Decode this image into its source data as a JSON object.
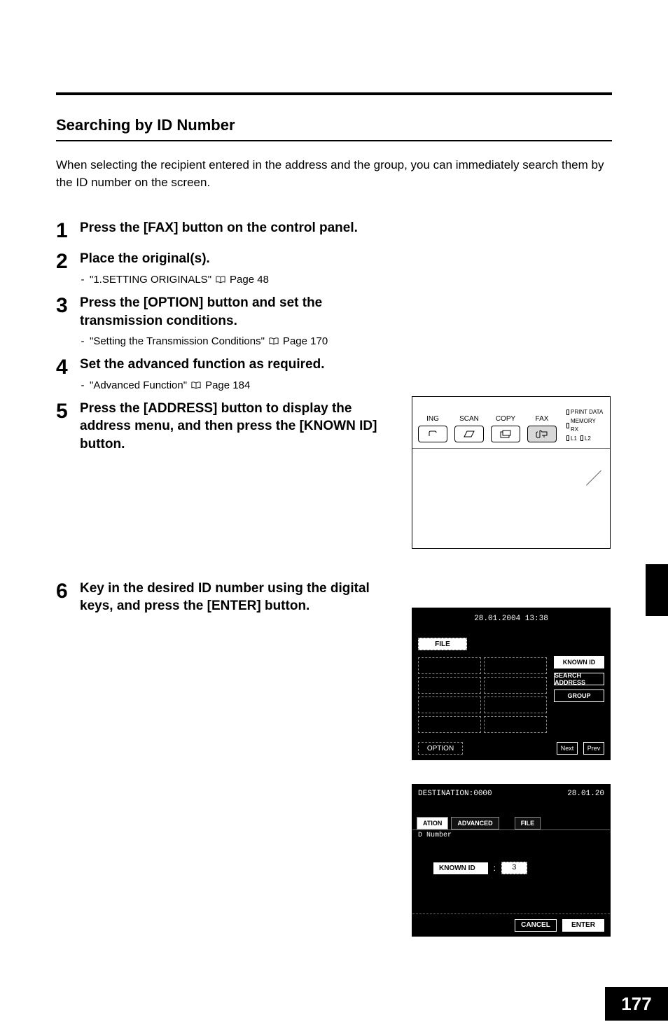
{
  "heading": "Searching by ID Number",
  "intro": "When selecting the recipient entered in the address and the group, you can immediately search them by the ID number on the screen.",
  "steps": [
    {
      "num": "1",
      "title": "Press the [FAX] button on the control panel."
    },
    {
      "num": "2",
      "title": "Place the original(s).",
      "ref_text": "\"1.SETTING ORIGINALS\"",
      "ref_page": "Page 48"
    },
    {
      "num": "3",
      "title": "Press the [OPTION] button and set the transmission conditions.",
      "ref_text": "\"Setting the Transmission Conditions\"",
      "ref_page": "Page 170"
    },
    {
      "num": "4",
      "title": "Set the advanced function as required.",
      "ref_text": "\"Advanced Function\"",
      "ref_page": "Page 184"
    },
    {
      "num": "5",
      "title": "Press the [ADDRESS] button to display the address menu, and then press the [KNOWN ID] button."
    },
    {
      "num": "6",
      "title": "Key in the desired ID number using the digital keys, and press the [ENTER] button."
    }
  ],
  "panel": {
    "btn1": "ING",
    "btn2": "SCAN",
    "btn3": "COPY",
    "btn4": "FAX",
    "side1": "PRINT DATA",
    "side2": "MEMORY RX",
    "side3": "L1",
    "side4": "L2"
  },
  "screen5": {
    "timestamp": "28.01.2004 13:38",
    "tab_file": "FILE",
    "btn_known": "KNOWN ID",
    "btn_search": "SEARCH ADDRESS",
    "btn_group": "GROUP",
    "btn_option": "OPTION",
    "btn_next": "Next",
    "btn_prev": "Prev"
  },
  "screen6": {
    "header_left": "DESTINATION:0000",
    "header_right": "28.01.20",
    "tab_ation": "ATION",
    "tab_advanced": "ADVANCED",
    "tab_file": "FILE",
    "subtitle": "D Number",
    "known_label": "KNOWN ID",
    "known_value": "3",
    "btn_cancel": "CANCEL",
    "btn_enter": "ENTER"
  },
  "page_number": "177"
}
